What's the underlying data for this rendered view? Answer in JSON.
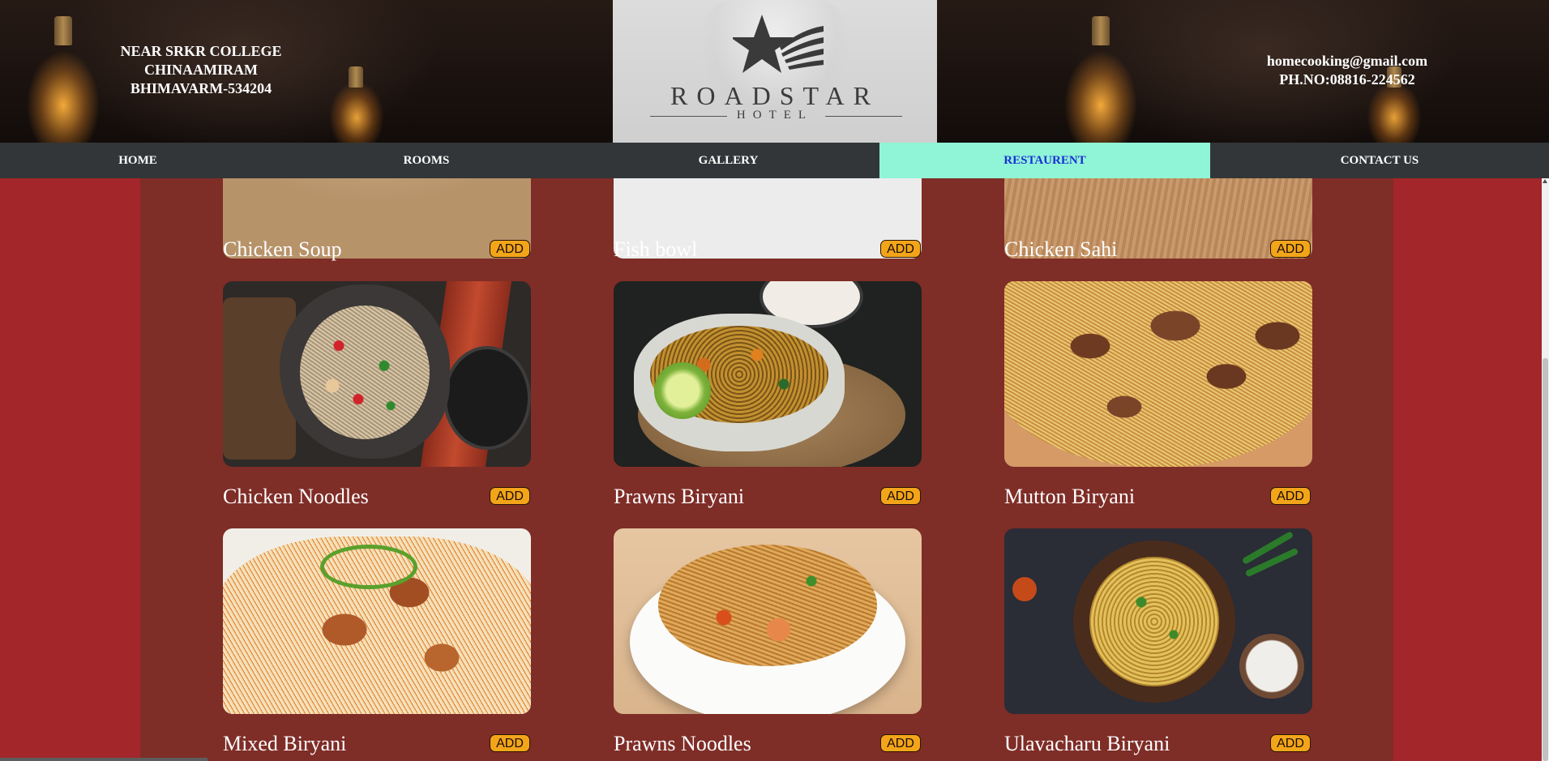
{
  "header": {
    "address_lines": [
      "NEAR SRKR COLLEGE",
      "CHINAAMIRAM",
      "BHIMAVARM-534204"
    ],
    "email": "homecooking@gmail.com",
    "phone": "PH.NO:08816-224562",
    "logo": {
      "name": "ROADSTAR",
      "sub": "HOTEL"
    }
  },
  "nav": {
    "items": [
      {
        "label": "HOME",
        "active": false
      },
      {
        "label": "ROOMS",
        "active": false
      },
      {
        "label": "GALLERY",
        "active": false
      },
      {
        "label": "RESTAURENT",
        "active": true
      },
      {
        "label": "CONTACT US",
        "active": false
      }
    ],
    "active_bg": "#90f5d6",
    "active_color": "#1a2fd6"
  },
  "menu": {
    "add_label": "ADD",
    "items": [
      {
        "name": "Chicken Soup"
      },
      {
        "name": "Fish bowl"
      },
      {
        "name": "Chicken Sahi"
      },
      {
        "name": "Chicken Noodles"
      },
      {
        "name": "Prawns Biryani"
      },
      {
        "name": "Mutton Biryani"
      },
      {
        "name": "Mixed Biryani"
      },
      {
        "name": "Prawns Noodles"
      },
      {
        "name": "Ulavacharu Biryani"
      }
    ]
  },
  "colors": {
    "page_bg": "#a3262a",
    "content_bg": "#7f2d27",
    "nav_bg": "#333638",
    "add_button": "#f3a51a"
  }
}
